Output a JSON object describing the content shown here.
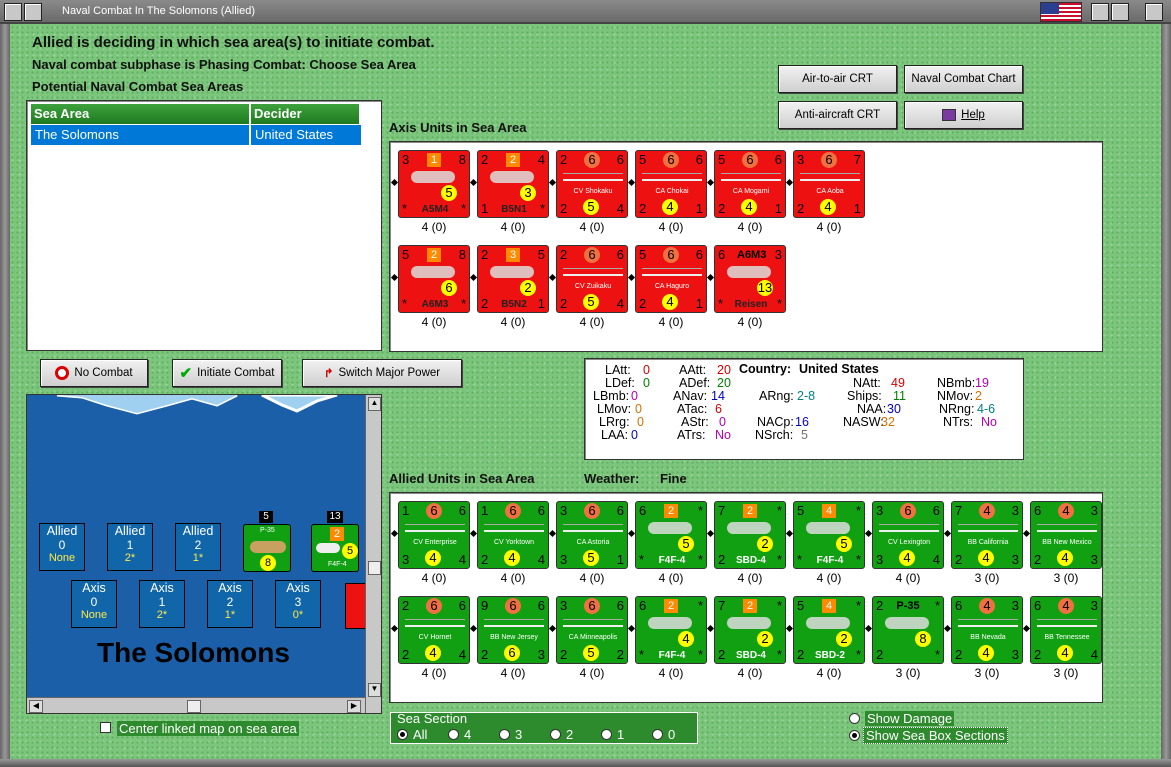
{
  "window": {
    "title": "Naval Combat In The Solomons (Allied)"
  },
  "header": {
    "line1": "Allied is deciding in which sea area(s) to initiate combat.",
    "line2": "Naval combat subphase is Phasing Combat: Choose Sea Area",
    "line3": "Potential Naval Combat Sea Areas"
  },
  "sea_table": {
    "col1": "Sea Area",
    "col2": "Decider",
    "row_area": "The Solomons",
    "row_decider": "United States"
  },
  "buttons": {
    "air_to_air": "Air-to-air CRT",
    "naval_chart": "Naval Combat Chart",
    "anti_aircraft": "Anti-aircraft CRT",
    "help": "Help",
    "no_combat": "No Combat",
    "initiate": "Initiate Combat",
    "switch": "Switch Major Power"
  },
  "axis": {
    "title": "Axis Units in Sea Area",
    "units": [
      {
        "tl": "3",
        "top": "1",
        "tr": "8",
        "bl": "*",
        "bot": "5",
        "br": "*",
        "name": "A5M4",
        "val": "4 (0)"
      },
      {
        "tl": "2",
        "top": "2",
        "tr": "4",
        "bl": "1",
        "bot": "3",
        "br": "*",
        "name": "B5N1",
        "val": "4 (0)"
      },
      {
        "tl": "2",
        "top": "6",
        "tr": "6",
        "bl": "2",
        "bot": "5",
        "br": "4",
        "name": "CV Shokaku",
        "val": "4 (0)"
      },
      {
        "tl": "5",
        "top": "6",
        "tr": "6",
        "bl": "2",
        "bot": "4",
        "br": "1",
        "name": "CA Chokai",
        "val": "4 (0)"
      },
      {
        "tl": "5",
        "top": "6",
        "tr": "6",
        "bl": "2",
        "bot": "4",
        "br": "1",
        "name": "CA Mogami",
        "val": "4 (0)"
      },
      {
        "tl": "3",
        "top": "6",
        "tr": "7",
        "bl": "2",
        "bot": "4",
        "br": "1",
        "name": "CA Aoba",
        "val": "4 (0)"
      },
      {
        "tl": "5",
        "top": "2",
        "tr": "8",
        "bl": "*",
        "bot": "6",
        "br": "*",
        "name": "A6M3",
        "val": "4 (0)"
      },
      {
        "tl": "2",
        "top": "3",
        "tr": "5",
        "bl": "2",
        "bot": "2",
        "br": "1",
        "name": "B5N2",
        "val": "4 (0)"
      },
      {
        "tl": "2",
        "top": "6",
        "tr": "6",
        "bl": "2",
        "bot": "5",
        "br": "4",
        "name": "CV Zuikaku",
        "val": "4 (0)"
      },
      {
        "tl": "5",
        "top": "6",
        "tr": "6",
        "bl": "2",
        "bot": "4",
        "br": "1",
        "name": "CA Haguro",
        "val": "4 (0)"
      },
      {
        "tl": "6",
        "top": "A6M3",
        "tr": "3",
        "bl": "*",
        "bot": "13",
        "br": "*",
        "name": "Reisen",
        "val": "4 (0)"
      }
    ]
  },
  "stats": {
    "LAtt": "0",
    "LDef": "0",
    "LBmb": "0",
    "LMov": "0",
    "LRrg": "0",
    "LAA": "0",
    "AAtt": "20",
    "ADef": "20",
    "ANav": "14",
    "ATac": "6",
    "AStr": "0",
    "ATrs": "No",
    "ARng": "2-8",
    "NACp": "16",
    "NSrch": "5",
    "country_label": "Country:",
    "country": "United States",
    "NAtt": "49",
    "Ships": "11",
    "NAA": "30",
    "NASW": "32",
    "NBmb": "19",
    "NMov": "2",
    "NRng": "4-6",
    "NTrs": "No",
    "colors": {
      "red": "#d00000",
      "green": "#008000",
      "purple": "#b000b0",
      "blue": "#0000c0",
      "teal": "#008080",
      "orange": "#d07000",
      "gray": "#707070"
    }
  },
  "allied": {
    "title": "Allied Units in Sea Area",
    "weather_label": "Weather:",
    "weather": "Fine",
    "units": [
      {
        "tl": "1",
        "top": "6",
        "tr": "6",
        "bl": "3",
        "bot": "4",
        "br": "4",
        "name": "CV Enterprise",
        "val": "4 (0)"
      },
      {
        "tl": "1",
        "top": "6",
        "tr": "6",
        "bl": "2",
        "bot": "4",
        "br": "4",
        "name": "CV Yorktown",
        "val": "4 (0)"
      },
      {
        "tl": "3",
        "top": "6",
        "tr": "6",
        "bl": "3",
        "bot": "5",
        "br": "1",
        "name": "CA Astoria",
        "val": "4 (0)"
      },
      {
        "tl": "6",
        "top": "2",
        "tr": "*",
        "bl": "*",
        "bot": "5",
        "br": "*",
        "name": "F4F-4",
        "val": "4 (0)"
      },
      {
        "tl": "7",
        "top": "2",
        "tr": "*",
        "bl": "2",
        "bot": "2",
        "br": "*",
        "name": "SBD-4",
        "val": "4 (0)"
      },
      {
        "tl": "5",
        "top": "4",
        "tr": "*",
        "bl": "*",
        "bot": "5",
        "br": "*",
        "name": "F4F-4",
        "val": "4 (0)"
      },
      {
        "tl": "3",
        "top": "6",
        "tr": "6",
        "bl": "3",
        "bot": "4",
        "br": "4",
        "name": "CV Lexington",
        "val": "4 (0)"
      },
      {
        "tl": "7",
        "top": "4",
        "tr": "3",
        "bl": "2",
        "bot": "4",
        "br": "3",
        "name": "BB California",
        "val": "3 (0)"
      },
      {
        "tl": "6",
        "top": "4",
        "tr": "3",
        "bl": "2",
        "bot": "4",
        "br": "3",
        "name": "BB New Mexico",
        "val": "3 (0)"
      },
      {
        "tl": "2",
        "top": "6",
        "tr": "6",
        "bl": "2",
        "bot": "4",
        "br": "4",
        "name": "CV Hornet",
        "val": "4 (0)"
      },
      {
        "tl": "9",
        "top": "6",
        "tr": "6",
        "bl": "2",
        "bot": "6",
        "br": "3",
        "name": "BB New Jersey",
        "val": "4 (0)"
      },
      {
        "tl": "3",
        "top": "6",
        "tr": "6",
        "bl": "2",
        "bot": "5",
        "br": "2",
        "name": "CA Minneapolis",
        "val": "4 (0)"
      },
      {
        "tl": "6",
        "top": "2",
        "tr": "*",
        "bl": "*",
        "bot": "4",
        "br": "*",
        "name": "F4F-4",
        "val": "4 (0)"
      },
      {
        "tl": "7",
        "top": "2",
        "tr": "*",
        "bl": "2",
        "bot": "2",
        "br": "*",
        "name": "SBD-4",
        "val": "4 (0)"
      },
      {
        "tl": "5",
        "top": "4",
        "tr": "*",
        "bl": "2",
        "bot": "2",
        "br": "*",
        "name": "SBD-2",
        "val": "4 (0)"
      },
      {
        "tl": "2",
        "top": "P-35",
        "tr": "*",
        "bl": "2",
        "bot": "8",
        "br": "*",
        "name": "",
        "val": "3 (0)"
      },
      {
        "tl": "6",
        "top": "4",
        "tr": "3",
        "bl": "2",
        "bot": "4",
        "br": "3",
        "name": "BB Nevada",
        "val": "3 (0)"
      },
      {
        "tl": "6",
        "top": "4",
        "tr": "3",
        "bl": "2",
        "bot": "4",
        "br": "4",
        "name": "BB Tennessee",
        "val": "3 (0)"
      }
    ]
  },
  "map": {
    "region_name": "The Solomons",
    "allied_boxes": [
      {
        "label": "Allied",
        "num": "0",
        "sub": "None"
      },
      {
        "label": "Allied",
        "num": "1",
        "sub": "2*"
      },
      {
        "label": "Allied",
        "num": "2",
        "sub": "1*"
      }
    ],
    "axis_boxes": [
      {
        "label": "Axis",
        "num": "0",
        "sub": "None"
      },
      {
        "label": "Axis",
        "num": "1",
        "sub": "2*"
      },
      {
        "label": "Axis",
        "num": "2",
        "sub": "1*"
      },
      {
        "label": "Axis",
        "num": "3",
        "sub": "0*"
      }
    ],
    "stack1": {
      "count": "5",
      "name": "P-35",
      "bot": "8"
    },
    "stack2": {
      "count": "13",
      "name": "F4F-4",
      "top": "2",
      "bot": "5"
    }
  },
  "center_label": "Center linked map on sea area",
  "sea_section": {
    "title": "Sea Section",
    "options": [
      "All",
      "4",
      "3",
      "2",
      "1",
      "0"
    ],
    "selected": "All"
  },
  "show_damage": "Show Damage",
  "show_sections": "Show Sea Box Sections"
}
